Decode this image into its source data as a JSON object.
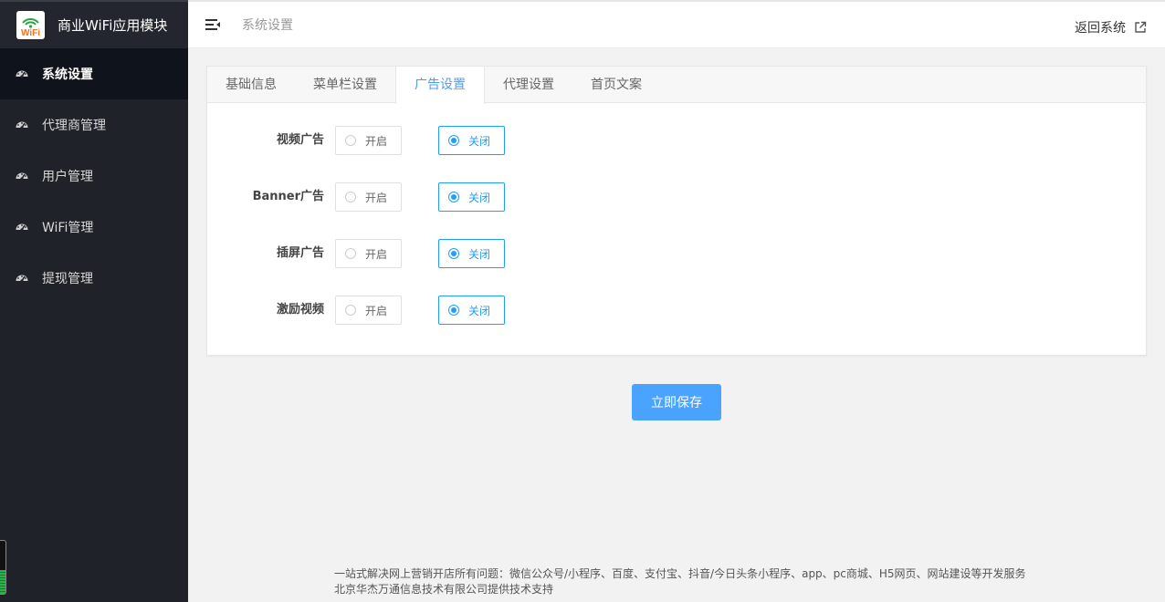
{
  "app": {
    "title": "商业WiFi应用模块",
    "logo_text": "WiFi"
  },
  "sidebar": {
    "items": [
      {
        "label": "系统设置",
        "icon": "dashboard-icon",
        "active": true
      },
      {
        "label": "代理商管理",
        "icon": "dashboard-icon",
        "active": false
      },
      {
        "label": "用户管理",
        "icon": "dashboard-icon",
        "active": false
      },
      {
        "label": "WiFi管理",
        "icon": "dashboard-icon",
        "active": false
      },
      {
        "label": "提现管理",
        "icon": "dashboard-icon",
        "active": false
      }
    ]
  },
  "header": {
    "breadcrumb": "系统设置",
    "back_label": "返回系统"
  },
  "tabs": [
    {
      "label": "基础信息",
      "active": false
    },
    {
      "label": "菜单栏设置",
      "active": false
    },
    {
      "label": "广告设置",
      "active": true
    },
    {
      "label": "代理设置",
      "active": false
    },
    {
      "label": "首页文案",
      "active": false
    }
  ],
  "form": {
    "on_label": "开启",
    "off_label": "关闭",
    "rows": [
      {
        "label": "视频广告",
        "value": "off"
      },
      {
        "label": "Banner广告",
        "value": "off"
      },
      {
        "label": "插屏广告",
        "value": "off"
      },
      {
        "label": "激励视频",
        "value": "off"
      }
    ]
  },
  "save_label": "立即保存",
  "footer": {
    "line1": "一站式解决网上营销开店所有问题：微信公众号/小程序、百度、支付宝、抖音/今日头条小程序、app、pc商城、H5网页、网站建设等开发服务",
    "line2": "北京华杰万通信息技术有限公司提供技术支持"
  },
  "colors": {
    "sidebar_bg": "#20222a",
    "accent": "#1e9fff",
    "button": "#4aa3ff"
  },
  "battery_level": 0.45
}
